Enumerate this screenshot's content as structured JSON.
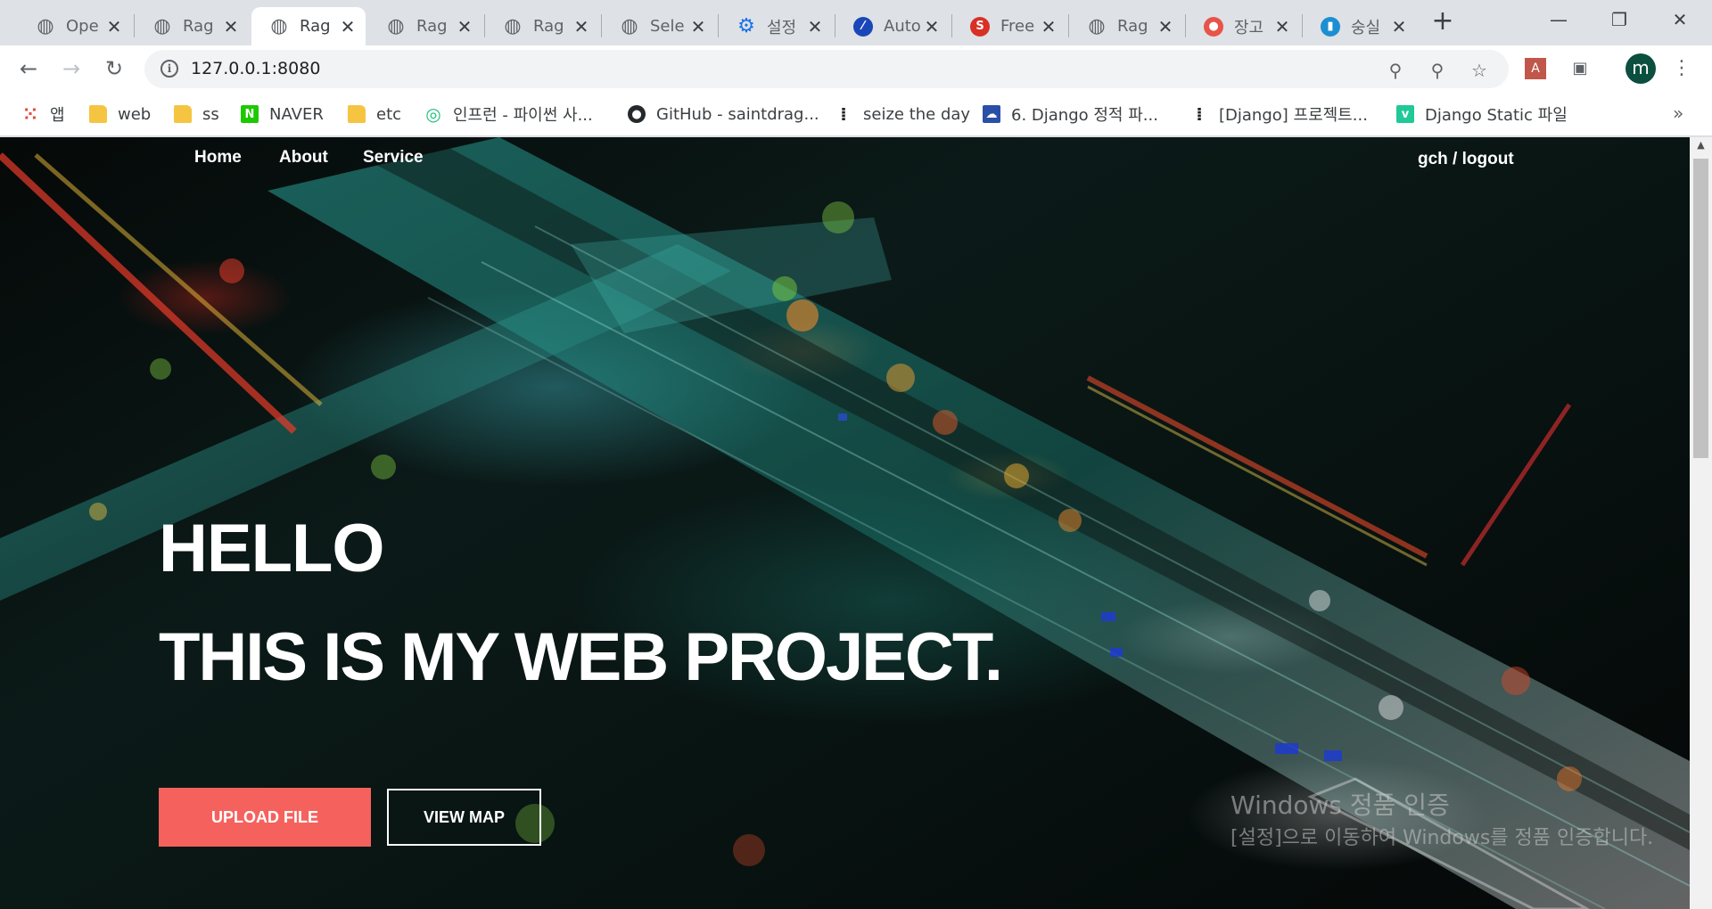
{
  "browser": {
    "tabs": [
      {
        "title": "Ope",
        "icon": "globe-icon",
        "active": false
      },
      {
        "title": "Rag",
        "icon": "globe-icon",
        "active": false
      },
      {
        "title": "Rag",
        "icon": "globe-icon",
        "active": true
      },
      {
        "title": "Rag",
        "icon": "globe-icon",
        "active": false
      },
      {
        "title": "Rag",
        "icon": "globe-icon",
        "active": false
      },
      {
        "title": "Sele",
        "icon": "globe-icon",
        "active": false
      },
      {
        "title": "설정",
        "icon": "gear-icon",
        "active": false
      },
      {
        "title": "Auto",
        "icon": "autodraw-icon",
        "active": false
      },
      {
        "title": "Free",
        "icon": "s-logo-icon",
        "active": false
      },
      {
        "title": "Rag",
        "icon": "globe-icon",
        "active": false
      },
      {
        "title": "장고",
        "icon": "donut-icon",
        "active": false
      },
      {
        "title": "숭실",
        "icon": "ssu-logo-icon",
        "active": false
      }
    ],
    "close_glyph": "✕",
    "new_tab_glyph": "+",
    "url": "127.0.0.1:8080",
    "profile_initial": "m",
    "colors": {
      "accent_button": "#f5625d",
      "avatar": "#0b4f3e"
    }
  },
  "bookmarks": [
    {
      "label": "앱",
      "icon": "apps-grid-icon"
    },
    {
      "label": "web",
      "icon": "folder-icon"
    },
    {
      "label": "ss",
      "icon": "folder-icon"
    },
    {
      "label": "NAVER",
      "icon": "naver-icon"
    },
    {
      "label": "etc",
      "icon": "folder-icon"
    },
    {
      "label": "인프런 - 파이썬 사...",
      "icon": "inflearn-icon"
    },
    {
      "label": "GitHub - saintdrag...",
      "icon": "github-icon"
    },
    {
      "label": "seize the day",
      "icon": "dots-icon"
    },
    {
      "label": "6. Django 정적 파...",
      "icon": "weather-icon"
    },
    {
      "label": "[Django] 프로젝트...",
      "icon": "dots-icon"
    },
    {
      "label": "Django Static 파일",
      "icon": "v-logo-icon"
    }
  ],
  "site": {
    "nav": {
      "home": "Home",
      "about": "About",
      "service": "Service"
    },
    "user": "gch / logout",
    "hero_line1": "HELLO",
    "hero_line2": "THIS IS MY WEB PROJECT.",
    "upload_button": "UPLOAD FILE",
    "map_button": "VIEW MAP"
  },
  "watermark": {
    "line1": "Windows 정품 인증",
    "line2": "[설정]으로 이동하여 Windows를 정품 인증합니다."
  }
}
